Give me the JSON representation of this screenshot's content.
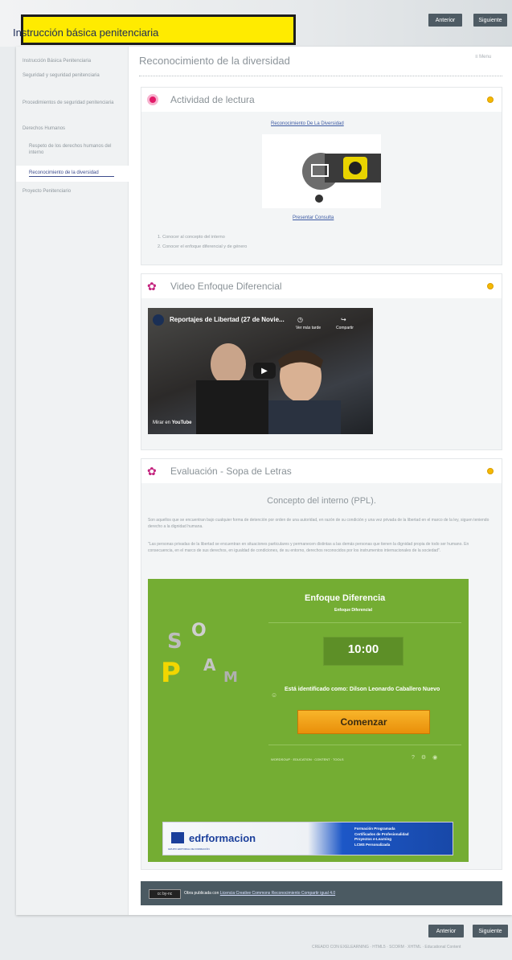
{
  "header": {
    "course_title": "Instrucción básica penitenciaria",
    "prev_label": "Anterior",
    "next_label": "Siguiente"
  },
  "sidebar": {
    "items": [
      {
        "label": "Instrucción Básica Penitenciaria"
      },
      {
        "label": "Seguridad y seguridad penitenciaria"
      },
      {
        "label": "Procedimientos de seguridad penitenciaria"
      },
      {
        "label": "Derechos Humanos"
      },
      {
        "label": "Respeto de los derechos humanos del interno"
      },
      {
        "label": "Reconocimiento de la diversidad"
      },
      {
        "label": "Proyecto Penitenciario"
      }
    ]
  },
  "page": {
    "title": "Reconocimiento de la diversidad",
    "menu_label": "Menu"
  },
  "reading": {
    "title": "Actividad de lectura",
    "link_top": "Reconocimiento De La Diversidad",
    "link_bottom": "Presentar Consulta",
    "bullets": [
      "1. Conocer al concepto del interno",
      "2. Conocer el enfoque diferencial y de género"
    ]
  },
  "video": {
    "title": "Video Enfoque Diferencial",
    "yt_title": "Reportajes de Libertad (27 de Novie...",
    "watch_later": "Ver más tarde",
    "share": "Compartir",
    "watch_on": "Mirar en",
    "youtube": "YouTube"
  },
  "evaluation": {
    "title": "Evaluación - Sopa de Letras",
    "concept_title": "Concepto del interno (PPL).",
    "paragraph1": "Son aquellos que se encuentran bajo cualquier forma de detención por orden de una autoridad, en razón de su condición y una vez privada de la libertad en el marco de la ley, siguen teniendo derecho a la dignidad humana.",
    "paragraph2": "\"Las personas privadas de la libertad se encuentran en situaciones particulares y permanecen distintas a las demás personas que tienen la dignidad propia de todo ser humano. En consecuencia, en el marco de sus derechos, en igualdad de condiciones, de su entorno, derechos reconocidos por los instrumentos internacionales de la sociedad\".",
    "quiz": {
      "heading": "Enfoque Diferencia",
      "sub": "Enfoque Diferencial",
      "timer": "10:00",
      "identified": "Está identificado como: Dilson Leonardo Caballero Nuevo",
      "start": "Comenzar",
      "footer_text": "WORDSOUP · EDUCATION · CONTENT · TOOLS",
      "ad_logo": "edrformacion",
      "ad_tagline": "GRUPO EDITORIAL DE FORMACIÓN",
      "ad_lines": [
        "Formación Programada",
        "Certificados de Profesionalidad",
        "Proyectos e-Learning",
        "LCMS Personalizada"
      ]
    }
  },
  "license": {
    "badge": "cc by-nc",
    "text": "Obra publicada con",
    "link": "Licencia Creative Commons Reconocimiento Compartir igual 4.0"
  },
  "footer": {
    "credit": "CREADO CON EXELEARNING · HTML5 · SCORM · XHTML · Educational Content"
  },
  "colors": {
    "accent_yellow": "#ffeb00",
    "status_dot": "#f5b900",
    "quiz_green": "#74ad33",
    "nav_button": "#4e5b64"
  }
}
